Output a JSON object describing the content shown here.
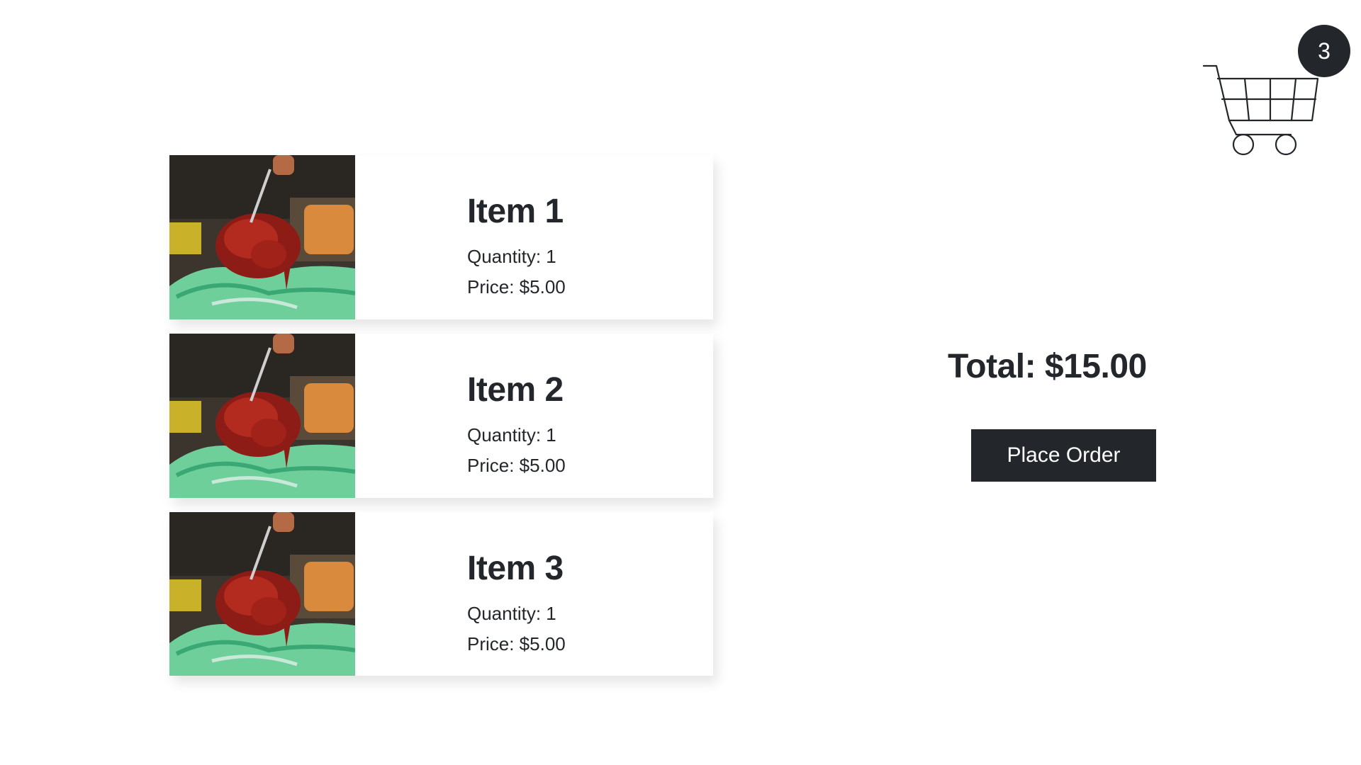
{
  "cart": {
    "count": "3",
    "icon": "shopping-cart-icon"
  },
  "items": [
    {
      "name": "Item 1",
      "quantity": "Quantity: 1",
      "price": "Price: $5.00",
      "image": "food-photo"
    },
    {
      "name": "Item 2",
      "quantity": "Quantity: 1",
      "price": "Price: $5.00",
      "image": "food-photo"
    },
    {
      "name": "Item 3",
      "quantity": "Quantity: 1",
      "price": "Price: $5.00",
      "image": "food-photo"
    }
  ],
  "summary": {
    "total": "Total: $15.00",
    "place_order_label": "Place Order"
  },
  "colors": {
    "primary": "#23272b",
    "background": "#ffffff",
    "badge_text": "#ffffff"
  }
}
